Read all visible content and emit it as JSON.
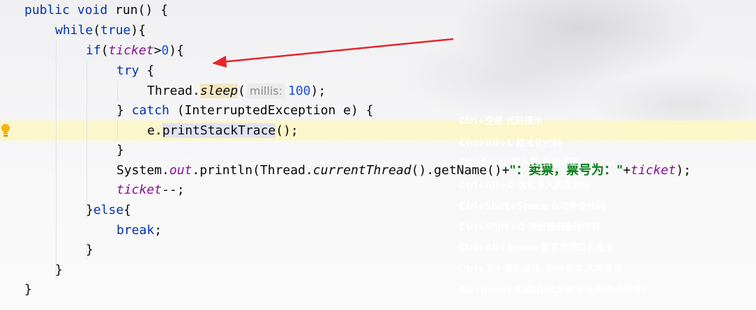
{
  "code": {
    "l1": {
      "pre": "public void ",
      "name": "run",
      "post": "() {"
    },
    "l2": {
      "kw": "while",
      "post": "(true){"
    },
    "l3": {
      "kw": "if",
      "open": "(",
      "field": "ticket",
      "gt": ">",
      "num": "0",
      "post": "){"
    },
    "l4": {
      "kw": "try",
      "post": " {"
    },
    "l5": {
      "cls": "Thread.",
      "method": "sleep",
      "open": "(",
      "hint": "millis:",
      "num": "100",
      "post": ");"
    },
    "l6": {
      "pre": "} ",
      "kw": "catch",
      "post": " (InterruptedException e) {"
    },
    "l7": {
      "pre": "e.",
      "method": "printStackTrace",
      "post": "();"
    },
    "l8": {
      "text": "}"
    },
    "l9": {
      "cls": "System.",
      "out": "out",
      "p1": ".println(Thread.",
      "cur": "currentThread",
      "p2": "().getName()+",
      "str": "\"：卖票，票号为：\"",
      "p3": "+",
      "field": "ticket",
      "p4": ");"
    },
    "l10": {
      "field": "ticket",
      "post": "--;"
    },
    "l11": {
      "pre": "}",
      "kw": "else",
      "post": "{"
    },
    "l12": {
      "kw": "break",
      "post": ";"
    },
    "l13": {
      "text": "}"
    },
    "l14": {
      "text": "}"
    },
    "l15": {
      "text": "}"
    }
  },
  "shortcuts": [
    "Ctrl+空格  代码提示",
    "Ctrl+Alt+L  格式化代码",
    "Alt+Enter  导入包,自动修正",
    "Ctrl+Alt+O  优化导入的类和包",
    "Ctrl+Shift+Space 自动补全代码",
    "Ctrl+Shift+O  弹出显示查找内容",
    "Ctrl+Alt+Space  类名或接口名提示",
    " Ctrl+ F9 重新编译, 删除缓存,实时更新",
    "Alt+Insert  生成(Get,Set方法,构造函数等)"
  ],
  "colors": {
    "keyword": "#0033b3",
    "field": "#871094",
    "number": "#1750eb",
    "string": "#067d17",
    "arrow": "#e8242a",
    "current_line": "#fcf7c4"
  },
  "icons": {
    "gutter": "lightbulb-icon"
  }
}
